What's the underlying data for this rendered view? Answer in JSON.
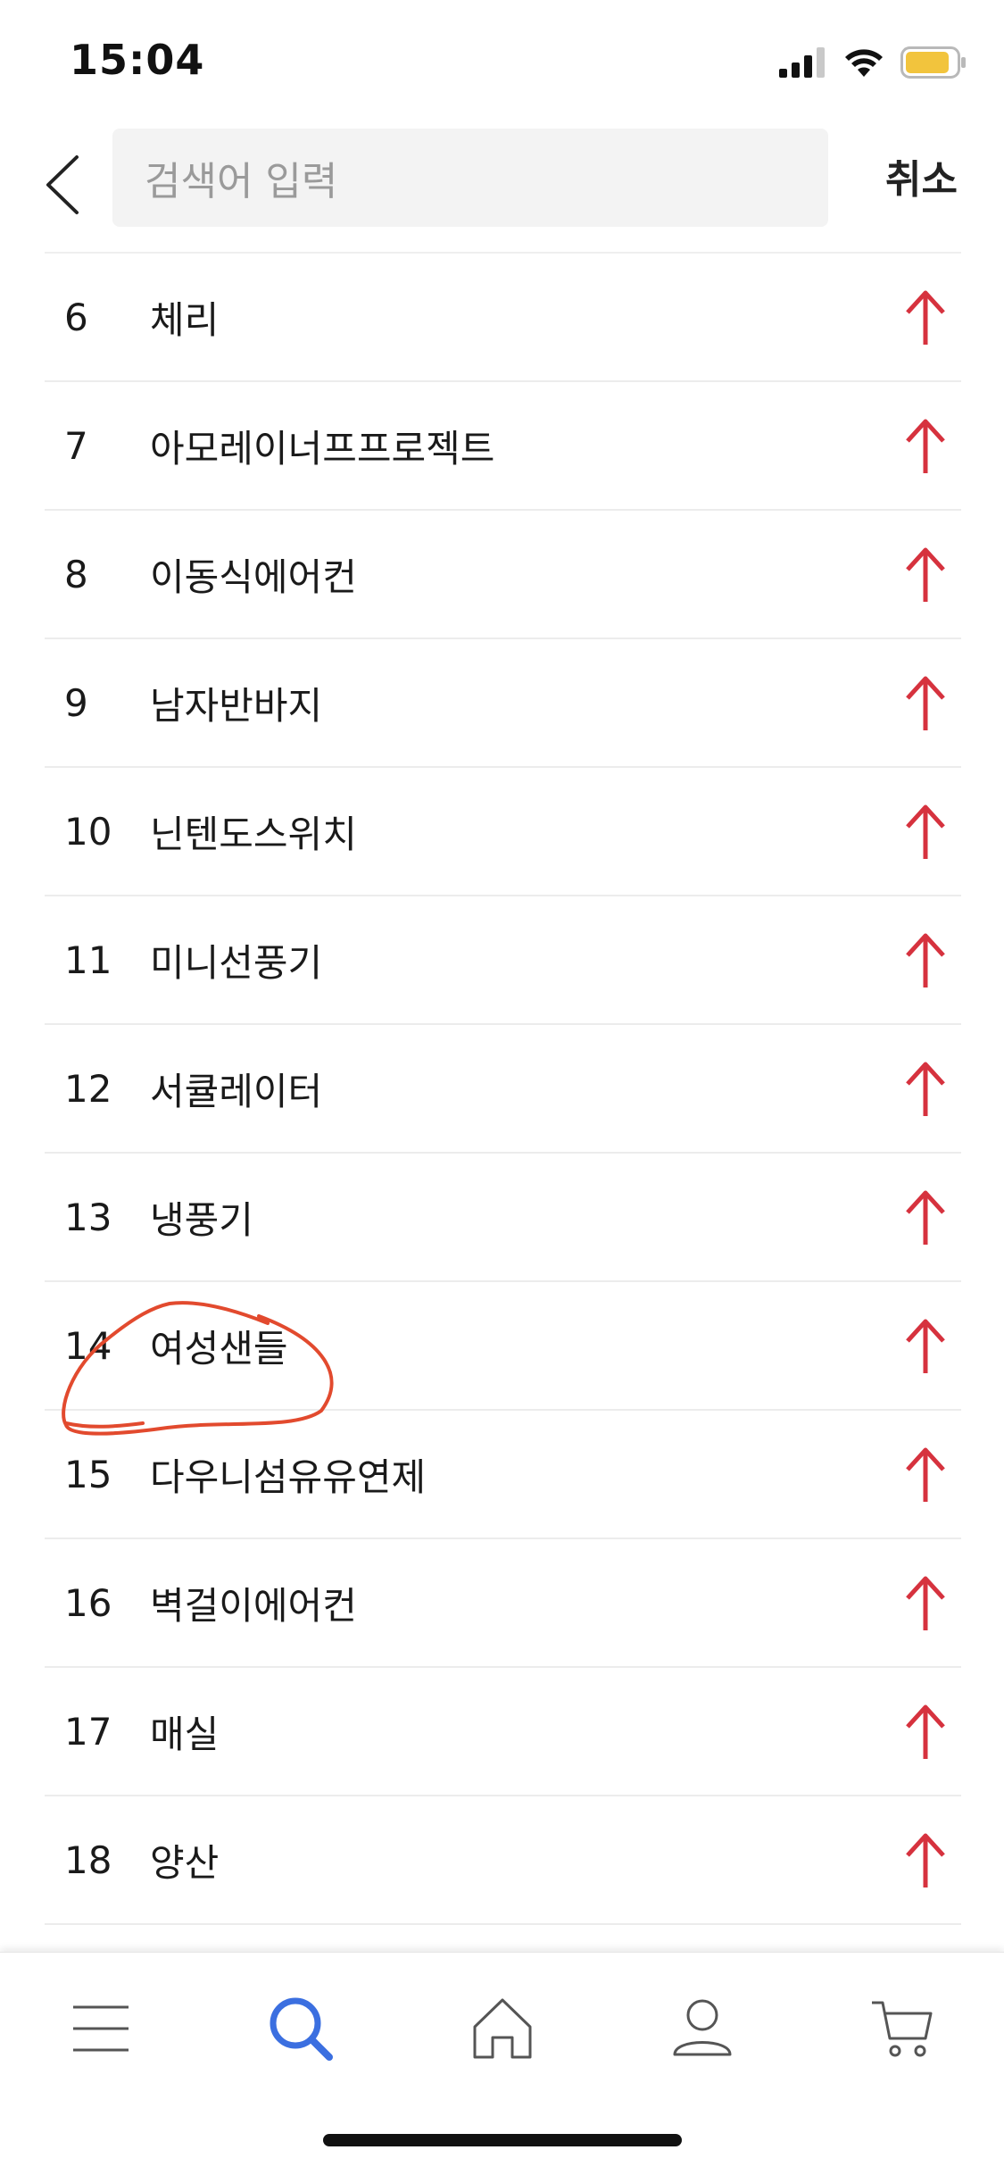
{
  "status_bar": {
    "time": "15:04",
    "icons": [
      "signal-icon",
      "wifi-icon",
      "battery-icon"
    ],
    "battery_color": "#f2c43d"
  },
  "header": {
    "search_placeholder": "검색어 입력",
    "cancel_label": "취소"
  },
  "rank_list": {
    "arrow_color": "#d6323e",
    "items": [
      {
        "rank": "6",
        "term": "체리"
      },
      {
        "rank": "7",
        "term": "아모레이너프프로젝트"
      },
      {
        "rank": "8",
        "term": "이동식에어컨"
      },
      {
        "rank": "9",
        "term": "남자반바지"
      },
      {
        "rank": "10",
        "term": "닌텐도스위치"
      },
      {
        "rank": "11",
        "term": "미니선풍기"
      },
      {
        "rank": "12",
        "term": "서큘레이터"
      },
      {
        "rank": "13",
        "term": "냉풍기"
      },
      {
        "rank": "14",
        "term": "여성샌들"
      },
      {
        "rank": "15",
        "term": "다우니섬유유연제"
      },
      {
        "rank": "16",
        "term": "벽걸이에어컨"
      },
      {
        "rank": "17",
        "term": "매실"
      },
      {
        "rank": "18",
        "term": "양산"
      }
    ]
  },
  "annotation": {
    "color": "#e24a2e",
    "target_rank": "14"
  },
  "tab_bar": {
    "items": [
      {
        "name": "menu-icon",
        "active": false
      },
      {
        "name": "search-icon",
        "active": true
      },
      {
        "name": "home-icon",
        "active": false
      },
      {
        "name": "profile-icon",
        "active": false
      },
      {
        "name": "cart-icon",
        "active": false
      }
    ],
    "active_color": "#3b6fe0",
    "inactive_color": "#555555"
  }
}
